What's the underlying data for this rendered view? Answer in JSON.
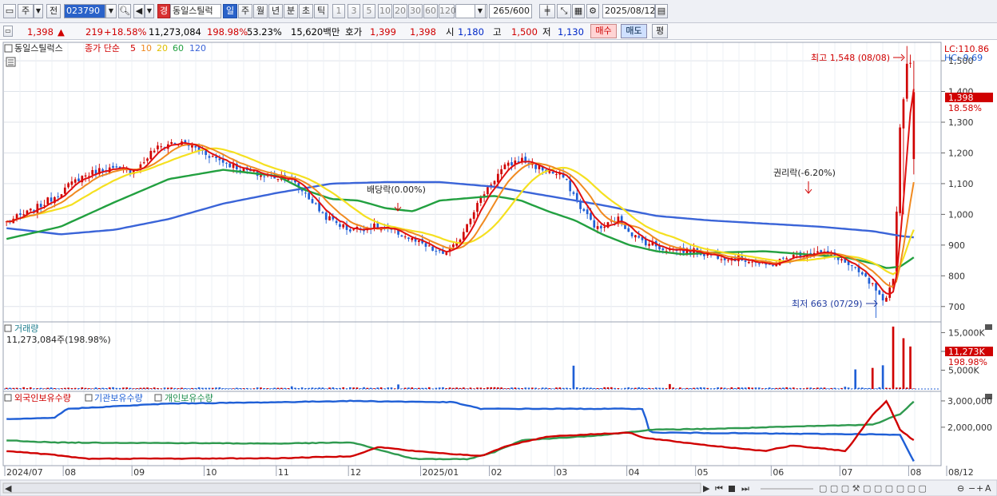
{
  "toolbar": {
    "period_label": "주",
    "prev_label": "전",
    "code": "023790",
    "stock_badge": "경",
    "stock_name": "동일스틸럭",
    "periods": [
      "일",
      "주",
      "월",
      "년",
      "분",
      "초",
      "틱"
    ],
    "active_period": "일",
    "intervals": [
      "1",
      "3",
      "5",
      "10",
      "20",
      "30",
      "60",
      "120"
    ],
    "count_value": "265",
    "count_total": "/600",
    "date": "2025/08/12"
  },
  "quote": {
    "price": "1,398",
    "up_arrow": "▲",
    "change": "219",
    "change_pct": "+18.58%",
    "volume": "11,273,084",
    "vol_ratio": "198.98%",
    "turnover": "53.23%",
    "amount": "15,620백만",
    "ask_label": "호가",
    "ask": "1,399",
    "bid": "1,398",
    "open_label": "시",
    "open": "1,180",
    "high_label": "고",
    "high": "1,500",
    "low_label": "저",
    "low": "1,130",
    "buy_label": "매수",
    "sell_label": "매도",
    "flat_label": "평"
  },
  "colors": {
    "up": "#d00000",
    "down": "#1f5fd6",
    "ma5": "#e01010",
    "ma10": "#f08a20",
    "ma20": "#f5e020",
    "ma60": "#22a040",
    "ma120": "#3a64d8"
  },
  "chart_data": [
    {
      "type": "candlestick",
      "legend": {
        "name": "동일스틸럭스",
        "ma_label": "종가 단순",
        "ma_periods": [
          "5",
          "10",
          "20",
          "60",
          "120"
        ]
      },
      "ylim": [
        650,
        1560
      ],
      "y_ticks": [
        "700",
        "800",
        "900",
        "1,000",
        "1,100",
        "1,200",
        "1,300",
        "1,400",
        "1,500"
      ],
      "x_ticks": [
        "2024/07",
        "08",
        "09",
        "10",
        "11",
        "12",
        "2025/01",
        "02",
        "03",
        "04",
        "05",
        "06",
        "07",
        "08",
        "08/12"
      ],
      "last_price": "1,398",
      "last_pct": "18.58%",
      "lc_label": "LC:110.86",
      "hc_label": "HC:-9.69",
      "annotations": {
        "high": "최고 1,548 (08/08)",
        "low": "최저 663 (07/29)",
        "dividend": "배당락(0.00%)",
        "rights": "권리락(-6.20%)"
      },
      "ma120_anchors": [
        [
          0,
          955
        ],
        [
          40,
          935
        ],
        [
          80,
          950
        ],
        [
          120,
          985
        ],
        [
          160,
          1035
        ],
        [
          200,
          1070
        ],
        [
          240,
          1100
        ],
        [
          280,
          1105
        ],
        [
          320,
          1105
        ],
        [
          360,
          1090
        ],
        [
          400,
          1060
        ],
        [
          440,
          1030
        ],
        [
          480,
          995
        ],
        [
          520,
          980
        ],
        [
          560,
          970
        ],
        [
          600,
          960
        ],
        [
          640,
          945
        ],
        [
          660,
          930
        ],
        [
          670,
          925
        ]
      ],
      "ma60_anchors": [
        [
          0,
          920
        ],
        [
          40,
          960
        ],
        [
          80,
          1040
        ],
        [
          120,
          1115
        ],
        [
          160,
          1145
        ],
        [
          200,
          1125
        ],
        [
          220,
          1080
        ],
        [
          240,
          1050
        ],
        [
          260,
          1045
        ],
        [
          280,
          1020
        ],
        [
          300,
          1010
        ],
        [
          320,
          1045
        ],
        [
          360,
          1060
        ],
        [
          380,
          1045
        ],
        [
          400,
          1010
        ],
        [
          420,
          980
        ],
        [
          440,
          935
        ],
        [
          460,
          900
        ],
        [
          480,
          880
        ],
        [
          500,
          870
        ],
        [
          520,
          875
        ],
        [
          560,
          880
        ],
        [
          620,
          860
        ],
        [
          640,
          840
        ],
        [
          650,
          825
        ],
        [
          660,
          830
        ],
        [
          670,
          860
        ]
      ]
    },
    {
      "type": "bar",
      "title": "거래량",
      "current": "11,273,084주(198.98%)",
      "y_ticks": [
        "5,000K",
        "10,000K",
        "15,000K"
      ],
      "last_label": "11,273K",
      "last_pct": "198.98%",
      "spikes": [
        [
          0,
          0.3
        ],
        [
          60,
          0.2
        ],
        [
          135,
          0.15
        ],
        [
          175,
          0.2
        ],
        [
          210,
          0.7
        ],
        [
          290,
          1.2
        ],
        [
          420,
          6.2
        ],
        [
          490,
          1.3
        ],
        [
          620,
          0.6
        ],
        [
          628,
          5.2
        ],
        [
          640,
          5.6
        ],
        [
          648,
          6.3
        ],
        [
          656,
          16.6
        ],
        [
          662,
          13.5
        ],
        [
          668,
          11.3
        ]
      ]
    },
    {
      "type": "line",
      "series": [
        {
          "name": "외국인보유수량"
        },
        {
          "name": "기관보유수량"
        },
        {
          "name": "개인보유수량"
        }
      ],
      "y_ticks": [
        "2,000,000",
        "3,000,000"
      ]
    }
  ]
}
